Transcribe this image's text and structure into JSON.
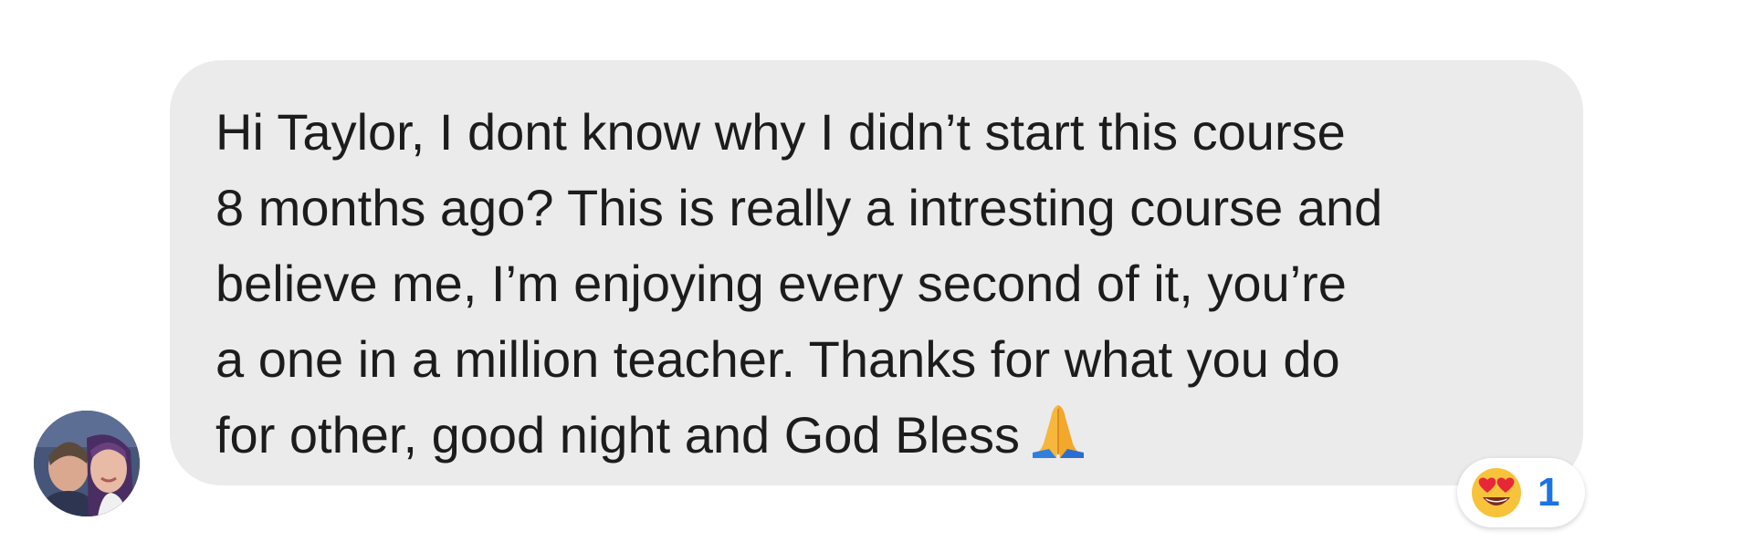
{
  "comment": {
    "author_avatar_icon": "profile-photo-avatar",
    "text": "Hi Taylor, I dont know why I didn’t start this course\n8 months ago? This is really a intresting course and\nbelieve me, I’m enjoying every second of it, you’re\na one in a million teacher. Thanks for what you do\nfor other, good night and God Bless",
    "trailing_emoji_icon": "folded-hands-icon"
  },
  "reactions": {
    "icon": "heart-eyes-icon",
    "count": "1"
  },
  "colors": {
    "bubble_background": "#ebebeb",
    "text": "#1c1c1c",
    "reaction_count": "#1b74e4"
  }
}
